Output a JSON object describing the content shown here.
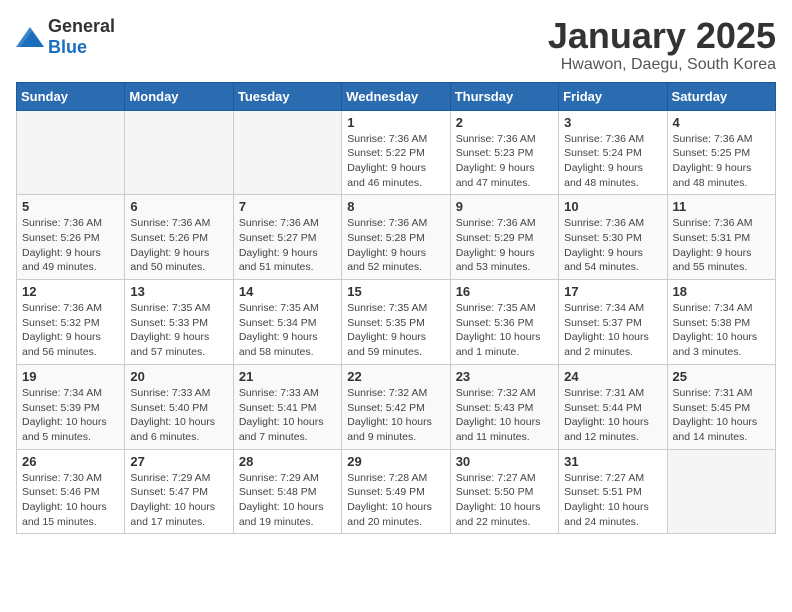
{
  "logo": {
    "general": "General",
    "blue": "Blue"
  },
  "title": "January 2025",
  "subtitle": "Hwawon, Daegu, South Korea",
  "weekdays": [
    "Sunday",
    "Monday",
    "Tuesday",
    "Wednesday",
    "Thursday",
    "Friday",
    "Saturday"
  ],
  "weeks": [
    [
      {
        "day": "",
        "info": ""
      },
      {
        "day": "",
        "info": ""
      },
      {
        "day": "",
        "info": ""
      },
      {
        "day": "1",
        "info": "Sunrise: 7:36 AM\nSunset: 5:22 PM\nDaylight: 9 hours\nand 46 minutes."
      },
      {
        "day": "2",
        "info": "Sunrise: 7:36 AM\nSunset: 5:23 PM\nDaylight: 9 hours\nand 47 minutes."
      },
      {
        "day": "3",
        "info": "Sunrise: 7:36 AM\nSunset: 5:24 PM\nDaylight: 9 hours\nand 48 minutes."
      },
      {
        "day": "4",
        "info": "Sunrise: 7:36 AM\nSunset: 5:25 PM\nDaylight: 9 hours\nand 48 minutes."
      }
    ],
    [
      {
        "day": "5",
        "info": "Sunrise: 7:36 AM\nSunset: 5:26 PM\nDaylight: 9 hours\nand 49 minutes."
      },
      {
        "day": "6",
        "info": "Sunrise: 7:36 AM\nSunset: 5:26 PM\nDaylight: 9 hours\nand 50 minutes."
      },
      {
        "day": "7",
        "info": "Sunrise: 7:36 AM\nSunset: 5:27 PM\nDaylight: 9 hours\nand 51 minutes."
      },
      {
        "day": "8",
        "info": "Sunrise: 7:36 AM\nSunset: 5:28 PM\nDaylight: 9 hours\nand 52 minutes."
      },
      {
        "day": "9",
        "info": "Sunrise: 7:36 AM\nSunset: 5:29 PM\nDaylight: 9 hours\nand 53 minutes."
      },
      {
        "day": "10",
        "info": "Sunrise: 7:36 AM\nSunset: 5:30 PM\nDaylight: 9 hours\nand 54 minutes."
      },
      {
        "day": "11",
        "info": "Sunrise: 7:36 AM\nSunset: 5:31 PM\nDaylight: 9 hours\nand 55 minutes."
      }
    ],
    [
      {
        "day": "12",
        "info": "Sunrise: 7:36 AM\nSunset: 5:32 PM\nDaylight: 9 hours\nand 56 minutes."
      },
      {
        "day": "13",
        "info": "Sunrise: 7:35 AM\nSunset: 5:33 PM\nDaylight: 9 hours\nand 57 minutes."
      },
      {
        "day": "14",
        "info": "Sunrise: 7:35 AM\nSunset: 5:34 PM\nDaylight: 9 hours\nand 58 minutes."
      },
      {
        "day": "15",
        "info": "Sunrise: 7:35 AM\nSunset: 5:35 PM\nDaylight: 9 hours\nand 59 minutes."
      },
      {
        "day": "16",
        "info": "Sunrise: 7:35 AM\nSunset: 5:36 PM\nDaylight: 10 hours\nand 1 minute."
      },
      {
        "day": "17",
        "info": "Sunrise: 7:34 AM\nSunset: 5:37 PM\nDaylight: 10 hours\nand 2 minutes."
      },
      {
        "day": "18",
        "info": "Sunrise: 7:34 AM\nSunset: 5:38 PM\nDaylight: 10 hours\nand 3 minutes."
      }
    ],
    [
      {
        "day": "19",
        "info": "Sunrise: 7:34 AM\nSunset: 5:39 PM\nDaylight: 10 hours\nand 5 minutes."
      },
      {
        "day": "20",
        "info": "Sunrise: 7:33 AM\nSunset: 5:40 PM\nDaylight: 10 hours\nand 6 minutes."
      },
      {
        "day": "21",
        "info": "Sunrise: 7:33 AM\nSunset: 5:41 PM\nDaylight: 10 hours\nand 7 minutes."
      },
      {
        "day": "22",
        "info": "Sunrise: 7:32 AM\nSunset: 5:42 PM\nDaylight: 10 hours\nand 9 minutes."
      },
      {
        "day": "23",
        "info": "Sunrise: 7:32 AM\nSunset: 5:43 PM\nDaylight: 10 hours\nand 11 minutes."
      },
      {
        "day": "24",
        "info": "Sunrise: 7:31 AM\nSunset: 5:44 PM\nDaylight: 10 hours\nand 12 minutes."
      },
      {
        "day": "25",
        "info": "Sunrise: 7:31 AM\nSunset: 5:45 PM\nDaylight: 10 hours\nand 14 minutes."
      }
    ],
    [
      {
        "day": "26",
        "info": "Sunrise: 7:30 AM\nSunset: 5:46 PM\nDaylight: 10 hours\nand 15 minutes."
      },
      {
        "day": "27",
        "info": "Sunrise: 7:29 AM\nSunset: 5:47 PM\nDaylight: 10 hours\nand 17 minutes."
      },
      {
        "day": "28",
        "info": "Sunrise: 7:29 AM\nSunset: 5:48 PM\nDaylight: 10 hours\nand 19 minutes."
      },
      {
        "day": "29",
        "info": "Sunrise: 7:28 AM\nSunset: 5:49 PM\nDaylight: 10 hours\nand 20 minutes."
      },
      {
        "day": "30",
        "info": "Sunrise: 7:27 AM\nSunset: 5:50 PM\nDaylight: 10 hours\nand 22 minutes."
      },
      {
        "day": "31",
        "info": "Sunrise: 7:27 AM\nSunset: 5:51 PM\nDaylight: 10 hours\nand 24 minutes."
      },
      {
        "day": "",
        "info": ""
      }
    ]
  ]
}
